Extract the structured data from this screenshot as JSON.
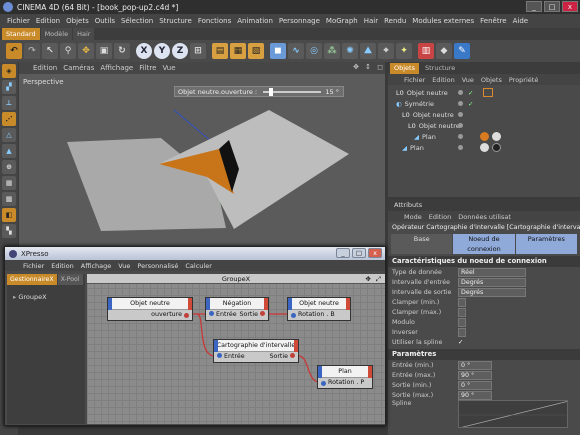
{
  "window": {
    "title": "CINEMA 4D (64 Bit) - [book_pop-up2.c4d *]",
    "min": "_",
    "max": "□",
    "close": "x"
  },
  "menu": [
    "Fichier",
    "Edition",
    "Objets",
    "Outils",
    "Sélection",
    "Structure",
    "Fonctions",
    "Animation",
    "Personnage",
    "MoGraph",
    "Hair",
    "Rendu",
    "Modules externes",
    "Fenêtre",
    "Aide"
  ],
  "layout_tabs": [
    "Standard",
    "Modèle",
    "Hair"
  ],
  "toolbar_axis": [
    "X",
    "Y",
    "Z"
  ],
  "viewport": {
    "menu": [
      "Edition",
      "Caméras",
      "Affichage",
      "Filtre",
      "Vue"
    ],
    "label": "Perspective",
    "hud_label": "Objet neutre.ouverture",
    "hud_value": "15 °"
  },
  "objects_panel": {
    "tabs": [
      "Objets",
      "Structure"
    ],
    "menu": [
      "Fichier",
      "Edition",
      "Vue",
      "Objets",
      "Propriété"
    ],
    "rows": [
      {
        "label": "Objet neutre"
      },
      {
        "label": "Symétrie"
      },
      {
        "label": "Objet neutre"
      },
      {
        "label": "Objet neutre"
      },
      {
        "label": "Plan"
      },
      {
        "label": "Plan"
      }
    ]
  },
  "attributes_panel": {
    "title": "Attributs",
    "menu": [
      "Mode",
      "Edition",
      "Données utilisat"
    ],
    "description": "Opérateur Cartographie d'intervalle [Cartographie d'intervalle]",
    "tabs": [
      "Base",
      "Noeud de connexion",
      "Paramètres"
    ],
    "section1": "Caractéristiques du noeud de connexion",
    "props1": [
      {
        "label": "Type de donnée",
        "value": "Réel"
      },
      {
        "label": "Intervalle d'entrée",
        "value": "Degrés"
      },
      {
        "label": "Intervalle de sortie",
        "value": "Degrés"
      },
      {
        "label": "Clamper (min.)",
        "value": ""
      },
      {
        "label": "Clamper (max.)",
        "value": ""
      },
      {
        "label": "Modulo",
        "value": ""
      },
      {
        "label": "Inverser",
        "value": ""
      },
      {
        "label": "Utiliser la spline",
        "value": "✓"
      }
    ],
    "section2": "Paramètres",
    "props2": [
      {
        "label": "Entrée (min.)",
        "value": "0 °"
      },
      {
        "label": "Entrée (max.)",
        "value": "90 °"
      },
      {
        "label": "Sortie (min.)",
        "value": "0 °"
      },
      {
        "label": "Sortie (max.)",
        "value": "90 °"
      },
      {
        "label": "Spline",
        "value": ""
      }
    ]
  },
  "xpresso": {
    "title": "XPresso",
    "menu": [
      "Fichier",
      "Edition",
      "Affichage",
      "Vue",
      "Personnalisé",
      "Calculer"
    ],
    "side_tabs": [
      "GestionnaireX",
      "X-Pool"
    ],
    "side_item": "GroupeX",
    "group_title": "GroupeX",
    "nodes": {
      "n1": {
        "title": "Objet neutre",
        "out": "ouverture"
      },
      "n2": {
        "title": "Négation",
        "in": "Entrée",
        "out": "Sortie"
      },
      "n3": {
        "title": "Objet neutre",
        "in": "Rotation . B"
      },
      "n4": {
        "title": "Cartographie d'intervalle",
        "in": "Entrée",
        "out": "Sortie"
      },
      "n5": {
        "title": "Plan",
        "in": "Rotation . P"
      }
    }
  }
}
